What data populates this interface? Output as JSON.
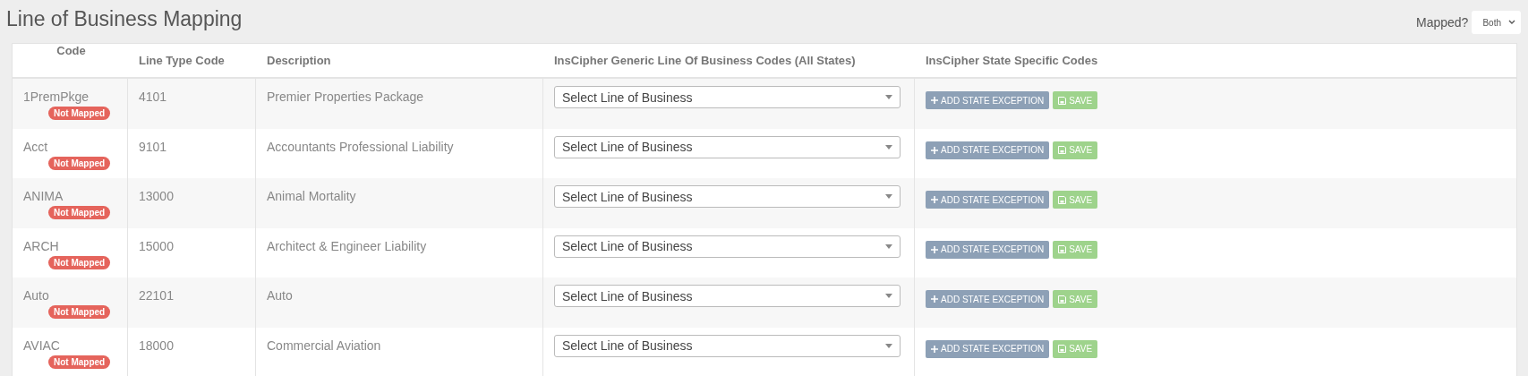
{
  "title": "Line of Business Mapping",
  "filter": {
    "label": "Mapped?",
    "value": "Both"
  },
  "table": {
    "columns": [
      "Code",
      "Line Type Code",
      "Description",
      "InsCipher Generic Line Of Business Codes (All States)",
      "InsCipher State Specific Codes"
    ],
    "rows": [
      {
        "code": "1PremPkge",
        "status": "Not Mapped",
        "line_type_code": "4101",
        "description": "Premier Properties Package",
        "select": {
          "placeholder": "Select Line of Business"
        },
        "actions": [
          "ADD STATE EXCEPTION",
          "SAVE"
        ]
      },
      {
        "code": "Acct",
        "status": "Not Mapped",
        "line_type_code": "9101",
        "description": "Accountants Professional Liability",
        "select": {
          "placeholder": "Select Line of Business"
        },
        "actions": [
          "ADD STATE EXCEPTION",
          "SAVE"
        ]
      },
      {
        "code": "ANIMA",
        "status": "Not Mapped",
        "line_type_code": "13000",
        "description": "Animal Mortality",
        "select": {
          "placeholder": "Select Line of Business"
        },
        "actions": [
          "ADD STATE EXCEPTION",
          "SAVE"
        ]
      },
      {
        "code": "ARCH",
        "status": "Not Mapped",
        "line_type_code": "15000",
        "description": "Architect & Engineer Liability",
        "select": {
          "placeholder": "Select Line of Business"
        },
        "actions": [
          "ADD STATE EXCEPTION",
          "SAVE"
        ]
      },
      {
        "code": "Auto",
        "status": "Not Mapped",
        "line_type_code": "22101",
        "description": "Auto",
        "select": {
          "placeholder": "Select Line of Business"
        },
        "actions": [
          "ADD STATE EXCEPTION",
          "SAVE"
        ]
      },
      {
        "code": "AVIAC",
        "status": "Not Mapped",
        "line_type_code": "18000",
        "description": "Commercial Aviation",
        "select": {
          "placeholder": "Select Line of Business"
        },
        "actions": [
          "ADD STATE EXCEPTION",
          "SAVE"
        ]
      }
    ]
  }
}
